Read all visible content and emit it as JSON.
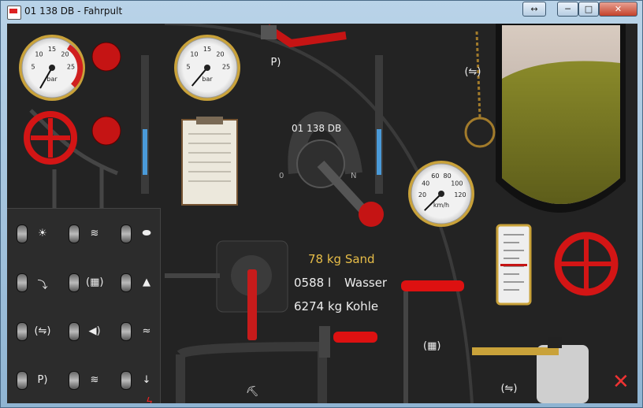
{
  "window": {
    "title": "01 138 DB - Fahrpult",
    "resize_icon": "↔",
    "min_icon": "─",
    "max_icon": "□",
    "close_icon": "✕"
  },
  "gauges": {
    "boiler_left": {
      "unit": "bar",
      "ticks": [
        "5",
        "10",
        "15",
        "20",
        "25"
      ]
    },
    "boiler_right": {
      "unit": "bar",
      "ticks": [
        "5",
        "10",
        "15",
        "20",
        "25"
      ]
    },
    "speed": {
      "unit": "km/h",
      "ticks": [
        "20",
        "40",
        "60",
        "80",
        "100",
        "120"
      ]
    }
  },
  "loco_label": "01 138 DB",
  "reverser_marks": {
    "left": "0",
    "right": "N"
  },
  "readouts": {
    "sand": "78 kg Sand",
    "wasser_value": "0588 l",
    "wasser_label": "Wasser",
    "kohle": "6274 kg Kohle"
  },
  "switches": [
    {
      "icon": "lamp-icon",
      "glyph": "☀"
    },
    {
      "icon": "radio-icon",
      "glyph": "≋"
    },
    {
      "icon": "turtle-icon",
      "glyph": "⬬"
    },
    {
      "icon": "faucet-icon",
      "glyph": "⤵"
    },
    {
      "icon": "brake-sound-icon",
      "glyph": "(▦)"
    },
    {
      "icon": "weight-icon",
      "glyph": "▲"
    },
    {
      "icon": "car-sound-icon",
      "glyph": "(⇋)"
    },
    {
      "icon": "speaker-icon",
      "glyph": "◀)"
    },
    {
      "icon": "signal-icon",
      "glyph": "≈"
    },
    {
      "icon": "announce-icon",
      "glyph": "P)"
    },
    {
      "icon": "wifi-icon",
      "glyph": "≋"
    },
    {
      "icon": "arrow-down-icon",
      "glyph": "↓"
    }
  ],
  "colors": {
    "accent_red": "#d01f1f",
    "sand_text": "#e7bd48",
    "gauge_rim": "#c9a23a"
  }
}
